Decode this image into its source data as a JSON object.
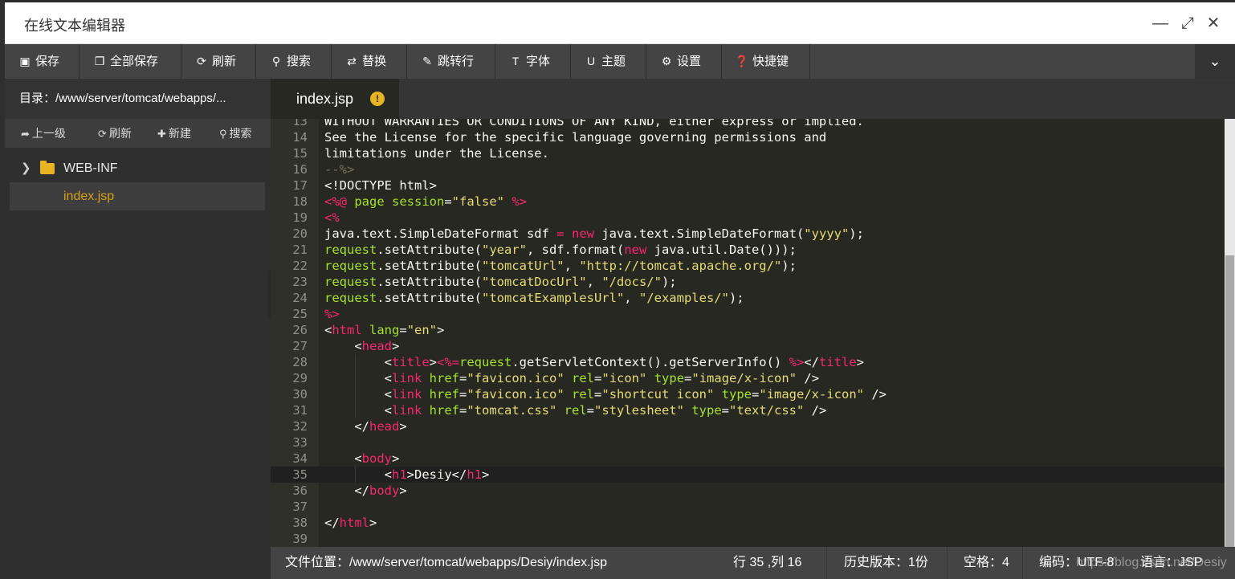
{
  "window": {
    "title": "在线文本编辑器"
  },
  "toolbar": {
    "items": [
      {
        "label": "保存",
        "icon": "save-icon"
      },
      {
        "label": "全部保存",
        "icon": "save-all-icon"
      },
      {
        "label": "刷新",
        "icon": "refresh-icon"
      },
      {
        "label": "搜索",
        "icon": "search-icon"
      },
      {
        "label": "替换",
        "icon": "replace-icon"
      },
      {
        "label": "跳转行",
        "icon": "pin-icon"
      },
      {
        "label": "字体",
        "icon": "font-icon"
      },
      {
        "label": "主题",
        "icon": "theme-icon"
      },
      {
        "label": "设置",
        "icon": "gear-icon"
      },
      {
        "label": "快捷键",
        "icon": "question-icon"
      }
    ]
  },
  "sidebar": {
    "directory": "目录：/www/server/tomcat/webapps/...",
    "actions": [
      {
        "label": "上一级",
        "icon": "up-level-icon"
      },
      {
        "label": "刷新",
        "icon": "refresh-icon"
      },
      {
        "label": "新建",
        "icon": "plus-icon"
      },
      {
        "label": "搜索",
        "icon": "search-icon"
      }
    ],
    "tree": [
      {
        "label": "WEB-INF",
        "type": "folder"
      },
      {
        "label": "index.jsp",
        "type": "file",
        "selected": true
      }
    ]
  },
  "tabs": [
    {
      "label": "index.jsp",
      "modified": true
    }
  ],
  "editor": {
    "first_line": 13,
    "active_line": 35,
    "lines": [
      [
        [
          "p",
          "WITHOUT WARRANTIES OR CONDITIONS OF ANY KIND, either express or implied."
        ]
      ],
      [
        [
          "p",
          "See the License for the specific language governing permissions and"
        ]
      ],
      [
        [
          "p",
          "limitations under the License."
        ]
      ],
      [
        [
          "c",
          "--%>"
        ]
      ],
      [
        [
          "p",
          "<!DOCTYPE html>"
        ]
      ],
      [
        [
          "t",
          "<%@ "
        ],
        [
          "a",
          "page "
        ],
        [
          "a",
          "session"
        ],
        [
          "p",
          "="
        ],
        [
          "s",
          "\"false\""
        ],
        [
          "t",
          " %>"
        ]
      ],
      [
        [
          "t",
          "<%"
        ]
      ],
      [
        [
          "p",
          "java.text.SimpleDateFormat sdf "
        ],
        [
          "t",
          "="
        ],
        [
          "p",
          " "
        ],
        [
          "t",
          "new"
        ],
        [
          "p",
          " java.text.SimpleDateFormat("
        ],
        [
          "s",
          "\"yyyy\""
        ],
        [
          "p",
          ");"
        ]
      ],
      [
        [
          "a",
          "request"
        ],
        [
          "p",
          ".setAttribute("
        ],
        [
          "s",
          "\"year\""
        ],
        [
          "p",
          ", sdf.format("
        ],
        [
          "t",
          "new"
        ],
        [
          "p",
          " java.util.Date()));"
        ]
      ],
      [
        [
          "a",
          "request"
        ],
        [
          "p",
          ".setAttribute("
        ],
        [
          "s",
          "\"tomcatUrl\""
        ],
        [
          "p",
          ", "
        ],
        [
          "s",
          "\"http://tomcat.apache.org/\""
        ],
        [
          "p",
          ");"
        ]
      ],
      [
        [
          "a",
          "request"
        ],
        [
          "p",
          ".setAttribute("
        ],
        [
          "s",
          "\"tomcatDocUrl\""
        ],
        [
          "p",
          ", "
        ],
        [
          "s",
          "\"/docs/\""
        ],
        [
          "p",
          ");"
        ]
      ],
      [
        [
          "a",
          "request"
        ],
        [
          "p",
          ".setAttribute("
        ],
        [
          "s",
          "\"tomcatExamplesUrl\""
        ],
        [
          "p",
          ", "
        ],
        [
          "s",
          "\"/examples/\""
        ],
        [
          "p",
          ");"
        ]
      ],
      [
        [
          "t",
          "%>"
        ]
      ],
      [
        [
          "p",
          "<"
        ],
        [
          "t",
          "html "
        ],
        [
          "a",
          "lang"
        ],
        [
          "p",
          "="
        ],
        [
          "s",
          "\"en\""
        ],
        [
          "p",
          ">"
        ]
      ],
      [
        [
          "p",
          "    <"
        ],
        [
          "t",
          "head"
        ],
        [
          "p",
          ">"
        ]
      ],
      [
        [
          "p",
          "        <"
        ],
        [
          "t",
          "title"
        ],
        [
          "p",
          ">"
        ],
        [
          "t",
          "<%="
        ],
        [
          "a",
          "request"
        ],
        [
          "p",
          ".getServletContext().getServerInfo() "
        ],
        [
          "t",
          "%>"
        ],
        [
          "p",
          "</"
        ],
        [
          "t",
          "title"
        ],
        [
          "p",
          ">"
        ]
      ],
      [
        [
          "p",
          "        <"
        ],
        [
          "t",
          "link "
        ],
        [
          "a",
          "href"
        ],
        [
          "p",
          "="
        ],
        [
          "s",
          "\"favicon.ico\""
        ],
        [
          "p",
          " "
        ],
        [
          "a",
          "rel"
        ],
        [
          "p",
          "="
        ],
        [
          "s",
          "\"icon\""
        ],
        [
          "p",
          " "
        ],
        [
          "a",
          "type"
        ],
        [
          "p",
          "="
        ],
        [
          "s",
          "\"image/x-icon\""
        ],
        [
          "p",
          " />"
        ]
      ],
      [
        [
          "p",
          "        <"
        ],
        [
          "t",
          "link "
        ],
        [
          "a",
          "href"
        ],
        [
          "p",
          "="
        ],
        [
          "s",
          "\"favicon.ico\""
        ],
        [
          "p",
          " "
        ],
        [
          "a",
          "rel"
        ],
        [
          "p",
          "="
        ],
        [
          "s",
          "\"shortcut icon\""
        ],
        [
          "p",
          " "
        ],
        [
          "a",
          "type"
        ],
        [
          "p",
          "="
        ],
        [
          "s",
          "\"image/x-icon\""
        ],
        [
          "p",
          " />"
        ]
      ],
      [
        [
          "p",
          "        <"
        ],
        [
          "t",
          "link "
        ],
        [
          "a",
          "href"
        ],
        [
          "p",
          "="
        ],
        [
          "s",
          "\"tomcat.css\""
        ],
        [
          "p",
          " "
        ],
        [
          "a",
          "rel"
        ],
        [
          "p",
          "="
        ],
        [
          "s",
          "\"stylesheet\""
        ],
        [
          "p",
          " "
        ],
        [
          "a",
          "type"
        ],
        [
          "p",
          "="
        ],
        [
          "s",
          "\"text/css\""
        ],
        [
          "p",
          " />"
        ]
      ],
      [
        [
          "p",
          "    </"
        ],
        [
          "t",
          "head"
        ],
        [
          "p",
          ">"
        ]
      ],
      [],
      [
        [
          "p",
          "    <"
        ],
        [
          "t",
          "body"
        ],
        [
          "p",
          ">"
        ]
      ],
      [
        [
          "p",
          "        <"
        ],
        [
          "t",
          "h1"
        ],
        [
          "p",
          ">Desiy</"
        ],
        [
          "t",
          "h1"
        ],
        [
          "p",
          ">"
        ]
      ],
      [
        [
          "p",
          "    </"
        ],
        [
          "t",
          "body"
        ],
        [
          "p",
          ">"
        ]
      ],
      [],
      [
        [
          "p",
          "</"
        ],
        [
          "t",
          "html"
        ],
        [
          "p",
          ">"
        ]
      ],
      []
    ]
  },
  "status": {
    "file_path": "文件位置：/www/server/tomcat/webapps/Desiy/index.jsp",
    "cursor": "行 35 ,列 16",
    "history": "历史版本：1份",
    "indent": "空格：4",
    "encoding": "编码：UTF-8",
    "language": "语言：JSP",
    "watermark": "https://blog.csdn.net/Desiy"
  }
}
